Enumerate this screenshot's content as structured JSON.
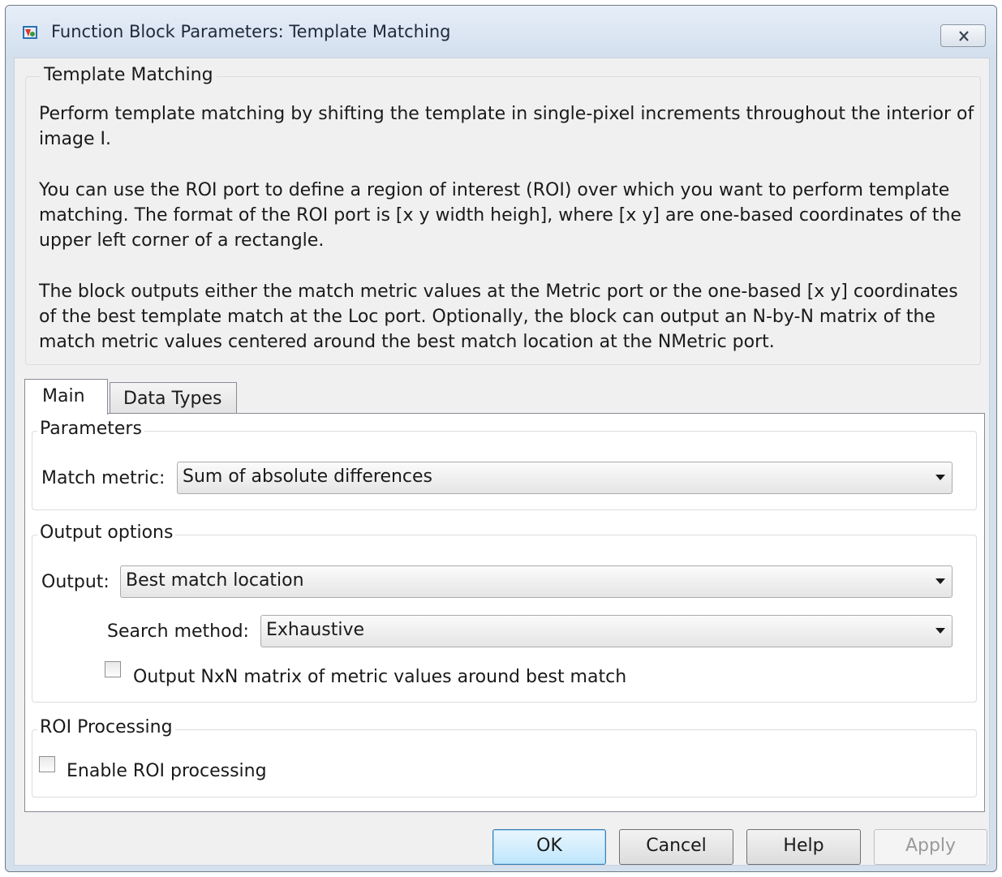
{
  "window": {
    "title": "Function Block Parameters: Template Matching"
  },
  "description": {
    "group_title": "Template Matching",
    "paragraphs": [
      "Perform template matching by shifting the template in single-pixel increments throughout the interior of image I.",
      "You can use the ROI port to define a region of interest (ROI) over which you want to perform template matching. The format of the ROI port is [x y width heigh], where [x y] are one-based coordinates of the upper left corner of a rectangle.",
      "The block outputs either the match metric values at the Metric port or the one-based [x y] coordinates of the best template match at the Loc port.  Optionally, the block can output an N-by-N matrix of the match metric values centered around the best match location at the NMetric port."
    ]
  },
  "tabs": [
    {
      "label": "Main",
      "selected": true
    },
    {
      "label": "Data Types",
      "selected": false
    }
  ],
  "parameters": {
    "group_title": "Parameters",
    "match_metric_label": "Match metric:",
    "match_metric_value": "Sum of absolute differences"
  },
  "output_options": {
    "group_title": "Output options",
    "output_label": "Output:",
    "output_value": "Best match location",
    "search_method_label": "Search method:",
    "search_method_value": "Exhaustive",
    "nxn_checkbox_label": "Output NxN matrix of metric values around best match",
    "nxn_checked": false
  },
  "roi_processing": {
    "group_title": "ROI Processing",
    "enable_label": "Enable ROI processing",
    "enable_checked": false
  },
  "buttons": {
    "ok": "OK",
    "cancel": "Cancel",
    "help": "Help",
    "apply": "Apply"
  }
}
